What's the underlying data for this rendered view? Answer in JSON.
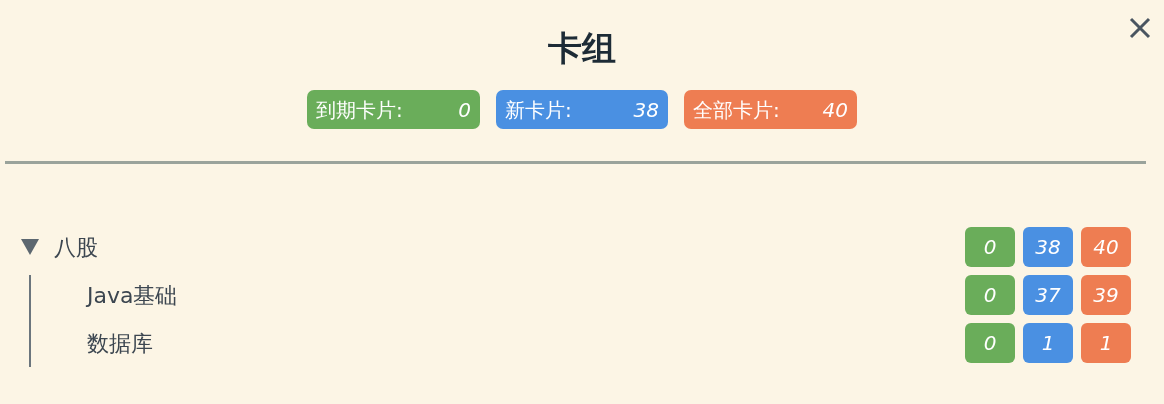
{
  "title": "卡组",
  "summary": [
    {
      "label": "到期卡片:",
      "value": "0",
      "color": "#6aad5a"
    },
    {
      "label": "新卡片:",
      "value": "38",
      "color": "#4a90e2"
    },
    {
      "label": "全部卡片:",
      "value": "40",
      "color": "#ee7d52"
    }
  ],
  "decks": [
    {
      "name": "八股",
      "expanded": true,
      "counts": [
        {
          "value": "0",
          "color": "#6aad5a"
        },
        {
          "value": "38",
          "color": "#4a90e2"
        },
        {
          "value": "40",
          "color": "#ee7d52"
        }
      ],
      "children": [
        {
          "name": "Java基础",
          "counts": [
            {
              "value": "0",
              "color": "#6aad5a"
            },
            {
              "value": "37",
              "color": "#4a90e2"
            },
            {
              "value": "39",
              "color": "#ee7d52"
            }
          ]
        },
        {
          "name": "数据库",
          "counts": [
            {
              "value": "0",
              "color": "#6aad5a"
            },
            {
              "value": "1",
              "color": "#4a90e2"
            },
            {
              "value": "1",
              "color": "#ee7d52"
            }
          ]
        }
      ]
    }
  ]
}
